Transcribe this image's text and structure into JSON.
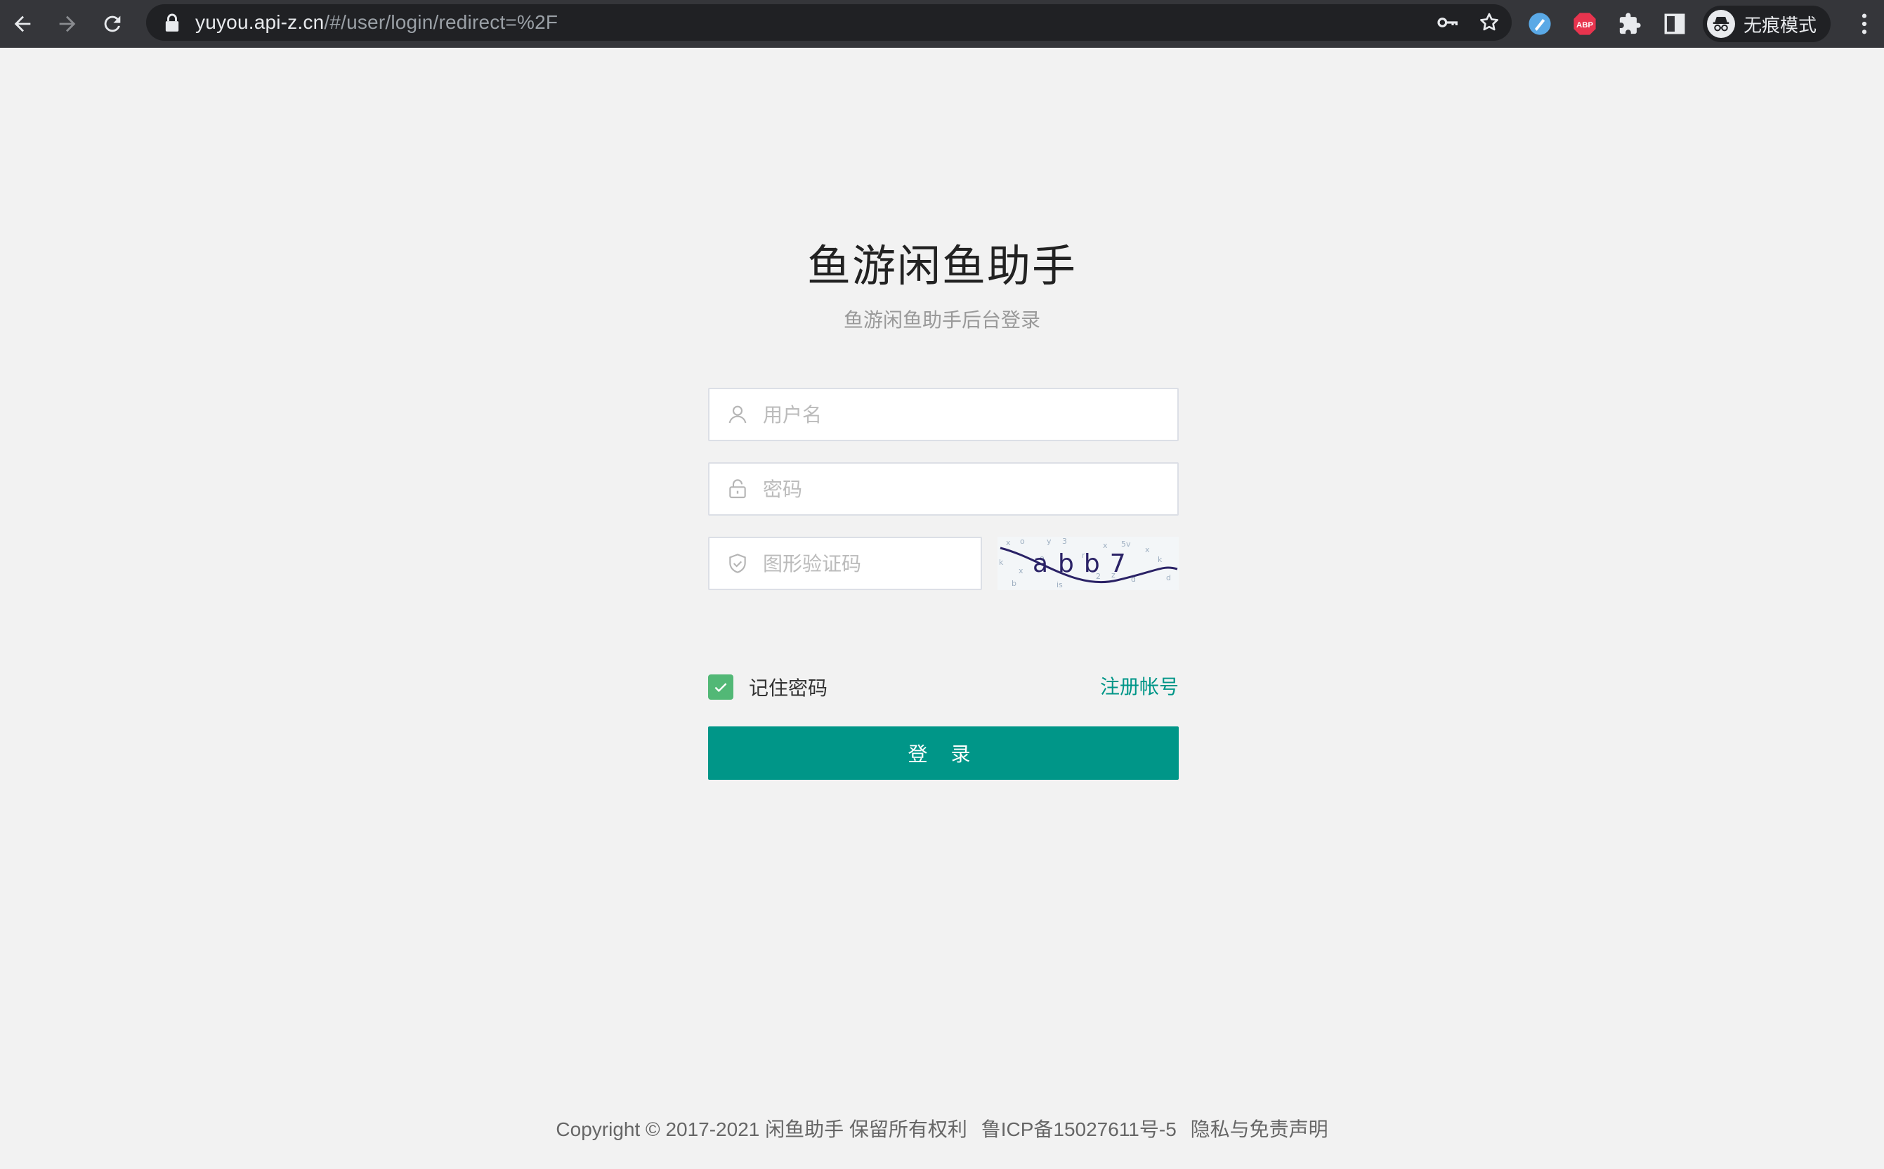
{
  "browser": {
    "url_host": "yuyou.api-z.cn",
    "url_path": "/#/user/login/redirect=%2F",
    "incognito_label": "无痕模式",
    "icons": [
      "back-arrow-icon",
      "forward-arrow-icon",
      "reload-icon",
      "lock-icon",
      "key-icon",
      "star-icon",
      "extension-blue-icon",
      "adblock-abp-icon",
      "puzzle-extensions-icon",
      "side-panel-icon",
      "incognito-icon",
      "more-vertical-icon"
    ],
    "abp_badge": "ABP"
  },
  "login": {
    "title": "鱼游闲鱼助手",
    "subtitle": "鱼游闲鱼助手后台登录",
    "username_placeholder": "用户名",
    "password_placeholder": "密码",
    "captcha_placeholder": "图形验证码",
    "captcha_text": "abb7",
    "remember_label": "记住密码",
    "remember_checked": true,
    "register_link": "注册帐号",
    "submit_label": "登 录",
    "icons": [
      "user-icon",
      "lock-icon",
      "shield-icon",
      "check-icon"
    ]
  },
  "footer": {
    "copyright": "Copyright © 2017-2021 闲鱼助手 保留所有权利",
    "icp": "鲁ICP备15027611号-5",
    "privacy": "隐私与免责声明"
  },
  "colors": {
    "primary": "#009688",
    "checkbox": "#52b876",
    "page_bg": "#f2f2f2",
    "toolbar_bg": "#35363a"
  }
}
